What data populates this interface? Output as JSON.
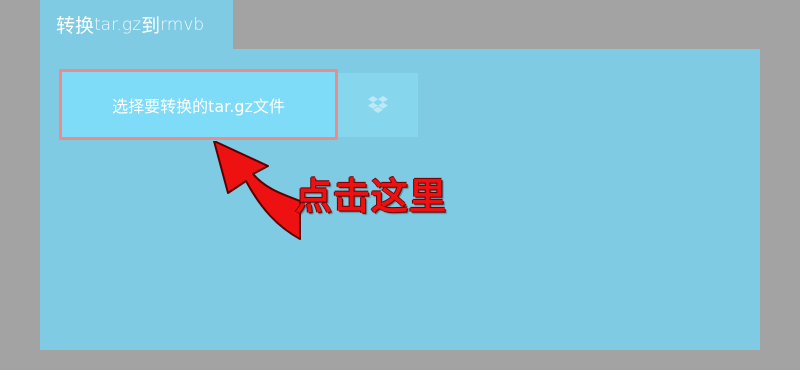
{
  "tab": {
    "part1": "转换",
    "part2": "tar.gz",
    "part3": "到",
    "part4": "rmvb"
  },
  "upload": {
    "choose_label": "选择要转换的tar.gz文件",
    "dropbox_icon": "dropbox-icon"
  },
  "annotation": {
    "text": "点击这里",
    "color": "#ee1111",
    "arrow_icon": "curved-arrow-icon"
  },
  "colors": {
    "background": "#a3a3a3",
    "panel": "#7ecbe3",
    "button": "#7fdcf9",
    "button_border": "#f08a86"
  }
}
